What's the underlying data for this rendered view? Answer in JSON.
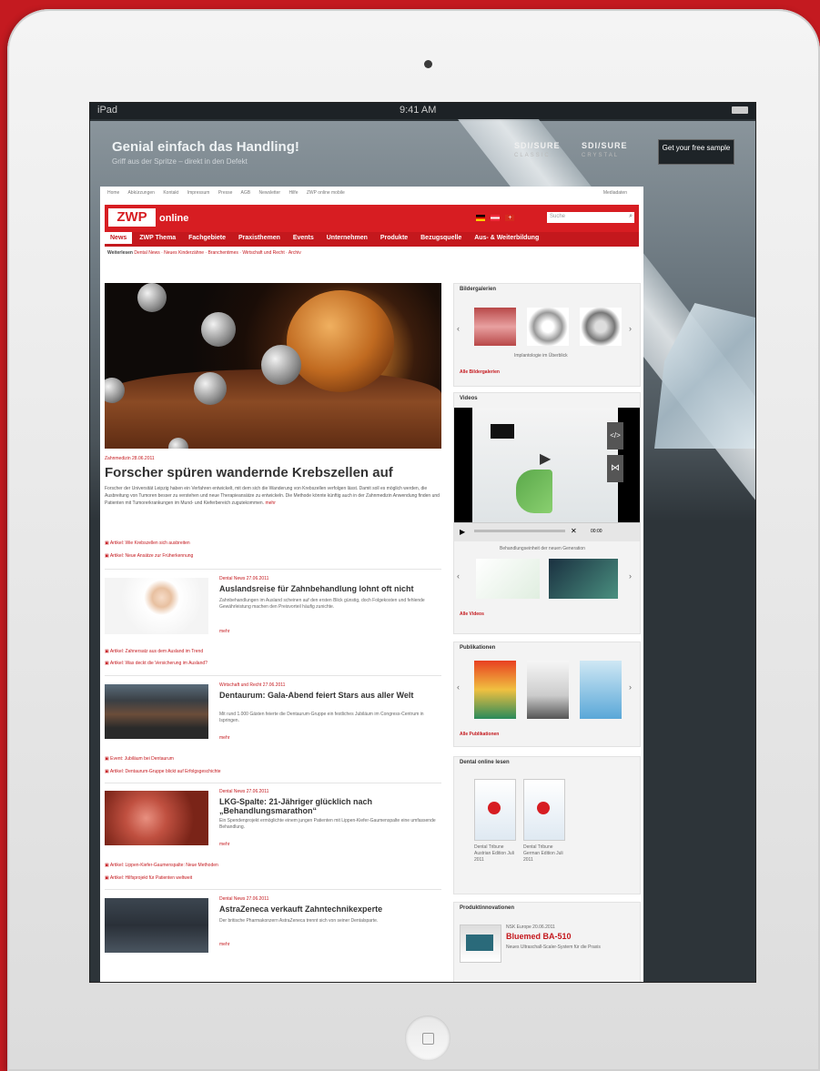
{
  "status": {
    "device": "iPad",
    "time": "9:41 AM"
  },
  "ad": {
    "title": "Genial einfach das Handling!",
    "subtitle": "Griff aus der Spritze – direkt in den Defekt",
    "logo1": "SDI/SURE",
    "logo1_sub": "CLASSIC",
    "logo2": "SDI/SURE",
    "logo2_sub": "CRYSTAL",
    "cta": "Get your free sample"
  },
  "topnav": {
    "items": [
      "Home",
      "Abkürzungen",
      "Kontakt",
      "Impressum",
      "Presse",
      "AGB",
      "Newsletter",
      "Hilfe",
      "ZWP online mobile"
    ],
    "right": "Mediadaten"
  },
  "header": {
    "logo": "ZWP",
    "logo_suffix": "online",
    "search_placeholder": "Suche"
  },
  "mainnav": [
    "News",
    "ZWP Thema",
    "Fachgebiete",
    "Praxisthemen",
    "Events",
    "Unternehmen",
    "Produkte",
    "Bezugsquelle",
    "Aus- & Weiterbildung"
  ],
  "subnav": {
    "label": "Weiterlesen",
    "items": "Dental News · Neues Kinderzähne · Branchentimes · Wirtschaft und Recht · Archiv"
  },
  "lead": {
    "meta": "Zahnmedizin 28.06.2011",
    "title": "Forscher spüren wandernde Krebszellen auf",
    "text": "Forscher der Universität Leipzig haben ein Verfahren entwickelt, mit dem sich die Wanderung von Krebszellen verfolgen lässt. Damit soll es möglich werden, die Ausbreitung von Tumoren besser zu verstehen und neue Therapieansätze zu entwickeln. Die Methode könnte künftig auch in der Zahnmedizin Anwendung finden und Patienten mit Tumorerkrankungen im Mund- und Kieferbereich zugutekommen.",
    "more": "mehr",
    "links": [
      "Artikel: Wie Krebszellen sich ausbreiten",
      "Artikel: Neue Ansätze zur Früherkennung"
    ]
  },
  "articles": [
    {
      "meta": "Dental News 27.06.2011",
      "title": "Auslandsreise für Zahnbehandlung lohnt oft nicht",
      "text": "Zahnbehandlungen im Ausland scheinen auf den ersten Blick günstig, doch Folgekosten und fehlende Gewährleistung machen den Preisvorteil häufig zunichte.",
      "more": "mehr",
      "links": [
        "Artikel: Zahnersatz aus dem Ausland im Trend",
        "Artikel: Was deckt die Versicherung im Ausland?"
      ]
    },
    {
      "meta": "Wirtschaft und Recht 27.06.2011",
      "title": "Dentaurum: Gala-Abend feiert Stars aus aller Welt",
      "text": "Mit rund 1.000 Gästen feierte die Dentaurum-Gruppe ein festliches Jubiläum im Congress-Centrum in Ispringen.",
      "more": "mehr",
      "links": [
        "Event: Jubiläum bei Dentaurum",
        "Artikel: Dentaurum-Gruppe blickt auf Erfolgsgeschichte"
      ]
    },
    {
      "meta": "Dental News 27.06.2011",
      "title": "LKG-Spalte: 21-Jähriger glücklich nach „Behandlungsmarathon“",
      "text": "Ein Spendenprojekt ermöglichte einem jungen Patienten mit Lippen-Kiefer-Gaumenspalte eine umfassende Behandlung.",
      "more": "mehr",
      "links": [
        "Artikel: Lippen-Kiefer-Gaumenspalte: Neue Methoden",
        "Artikel: Hilfsprojekt für Patienten weltweit"
      ]
    },
    {
      "meta": "Dental News 27.06.2011",
      "title": "AstraZeneca verkauft Zahntechnikexperte",
      "text": "Der britische Pharmakonzern AstraZeneca trennt sich von seiner Dentalsparte.",
      "more": "mehr",
      "links": []
    }
  ],
  "sidebar": {
    "gallery": {
      "heading": "Bildergalerien",
      "caption": "Implantologie im Überblick",
      "link": "Alle Bildergalerien"
    },
    "videos": {
      "heading": "Videos",
      "caption": "Behandlungseinheit der neuen Generation",
      "time": "00:00",
      "link": "Alle Videos"
    },
    "publications": {
      "heading": "Publikationen",
      "link": "Alle Publikationen"
    },
    "epaper": {
      "heading": "Dental online lesen",
      "items": [
        "Dental Tribune Austrian Edition Juli 2011",
        "Dental Tribune German Edition Juli 2011"
      ]
    },
    "products": {
      "heading": "Produktinnovationen",
      "meta": "NSK Europe 20.06.2011",
      "title": "Bluemed BA-510",
      "text": "Neues Ultraschall-Scaler-System für die Praxis"
    }
  },
  "colors": {
    "brand_red": "#d71d22",
    "nav_red": "#c4181d",
    "frame": "#c41a20"
  }
}
